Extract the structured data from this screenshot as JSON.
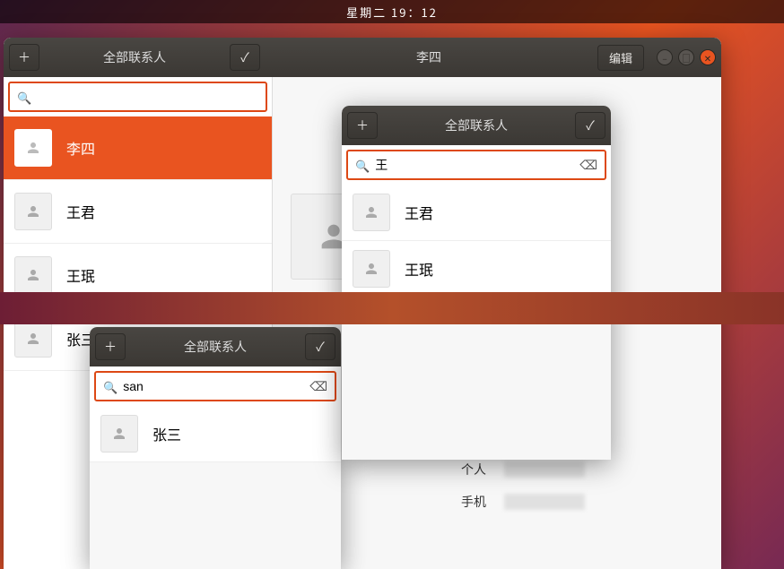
{
  "topbar": {
    "datetime": "星期二 19：12"
  },
  "main_window": {
    "titlebar": {
      "add_tooltip": "+",
      "list_title": "全部联系人",
      "check": "✓",
      "detail_title": "李四",
      "edit_label": "编辑"
    },
    "search": {
      "placeholder": "",
      "value": ""
    },
    "contacts": [
      {
        "name": "李四",
        "selected": true
      },
      {
        "name": "王君",
        "selected": false
      },
      {
        "name": "王珉",
        "selected": false
      },
      {
        "name": "张三",
        "selected": false
      }
    ],
    "detail": {
      "name": "李四",
      "fields": [
        {
          "label": "个人"
        },
        {
          "label": "手机"
        }
      ]
    }
  },
  "window2": {
    "titlebar": {
      "list_title": "全部联系人",
      "check": "✓"
    },
    "search": {
      "value": "san"
    },
    "contacts": [
      {
        "name": "张三"
      }
    ]
  },
  "window3": {
    "titlebar": {
      "list_title": "全部联系人",
      "check": "✓"
    },
    "search": {
      "value": "王"
    },
    "contacts": [
      {
        "name": "王君"
      },
      {
        "name": "王珉"
      }
    ]
  },
  "extra_detail": {
    "fields": [
      {
        "label": "个人"
      },
      {
        "label": "手机"
      }
    ]
  }
}
